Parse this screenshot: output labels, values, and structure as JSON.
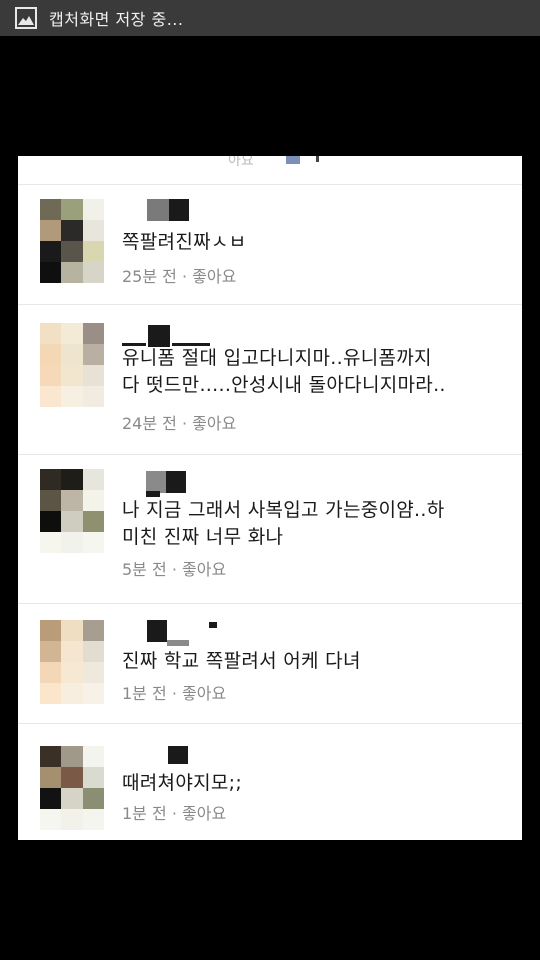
{
  "statusbar": {
    "icon": "image-icon",
    "title": "캡처화면 저장 중..."
  },
  "top_strip": {
    "partial_text": "아요"
  },
  "comments": [
    {
      "text": "쪽팔려진짜ㅅㅂ",
      "time": "25분 전",
      "sep": "·",
      "like": "좋아요",
      "avatar": [
        "#6e6a55",
        "#9aa07a",
        "#f1f1ea",
        "#b09a7a",
        "#2c2a28",
        "#e8e6dc",
        "#1a1a1a",
        "#5a554a",
        "#d9d7b0",
        "#0f0f0f",
        "#b6b3a0",
        "#d7d5c8"
      ]
    },
    {
      "text": "유니폼 절대 입고다니지마..유니폼까지\n다 떳드만.....안성시내 돌아다니지마라..",
      "time": "24분 전",
      "sep": "·",
      "like": "좋아요",
      "avatar": [
        "#f1e0c4",
        "#f4ebd6",
        "#9a8e86",
        "#f4d7b4",
        "#efe5cf",
        "#b9b0a3",
        "#f6d9b8",
        "#f3e6cf",
        "#e8e2d6",
        "#fbe7cf",
        "#f7efe1",
        "#f1ebe2"
      ]
    },
    {
      "text": "나 지금 그래서 사복입고 가는중이얌..하\n미친 진짜 너무 화나",
      "time": "5분 전",
      "sep": "·",
      "like": "좋아요",
      "avatar": [
        "#2f2a22",
        "#1f1d18",
        "#e6e6dd",
        "#5c5546",
        "#bdb6a6",
        "#f3f3ea",
        "#0e0e0c",
        "#cfcdbf",
        "#8e9070",
        "#f6f5ee",
        "#f2f2ec",
        "#f6f6f0"
      ]
    },
    {
      "text": "진짜 학교 쪽팔려서 어케 다녀",
      "time": "1분 전",
      "sep": "·",
      "like": "좋아요",
      "avatar": [
        "#b89d78",
        "#f0dec2",
        "#a79d90",
        "#d2b593",
        "#f4e6cf",
        "#e3dcd0",
        "#f4d7b6",
        "#f6e8d2",
        "#efe8dc",
        "#fbe6cc",
        "#f8eedf",
        "#f7f1e8"
      ]
    },
    {
      "text": "때려쳐야지모;;",
      "time": "1분 전",
      "sep": "·",
      "like": "좋아요",
      "avatar": [
        "#3a3026",
        "#a09888",
        "#f4f4ee",
        "#a4906e",
        "#7a5a46",
        "#d9dbd0",
        "#121212",
        "#d6d4c6",
        "#8b8e72",
        "#f6f6f0",
        "#f3f2ea",
        "#f5f5ef"
      ]
    }
  ]
}
